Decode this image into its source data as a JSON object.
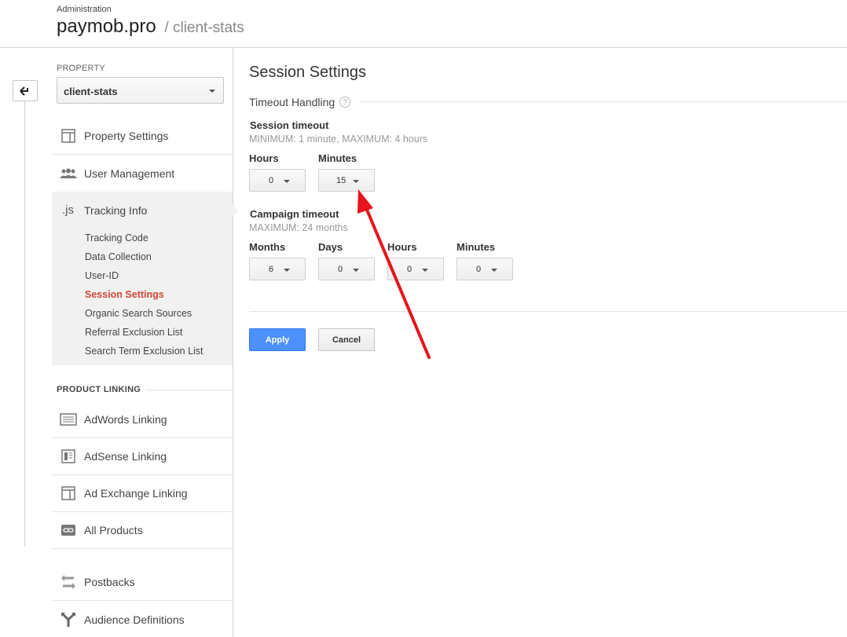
{
  "header": {
    "admin_label": "Administration",
    "account_name": "paymob.pro",
    "property_path": "/ client-stats"
  },
  "sidebar": {
    "property_label": "PROPERTY",
    "property_selected": "client-stats",
    "items": [
      {
        "label": "Property Settings",
        "icon": "property-settings-icon"
      },
      {
        "label": "User Management",
        "icon": "users-icon"
      },
      {
        "label": "Tracking Info",
        "icon": "js-icon"
      }
    ],
    "tracking_subitems": [
      {
        "label": "Tracking Code"
      },
      {
        "label": "Data Collection"
      },
      {
        "label": "User-ID"
      },
      {
        "label": "Session Settings",
        "active": true
      },
      {
        "label": "Organic Search Sources"
      },
      {
        "label": "Referral Exclusion List"
      },
      {
        "label": "Search Term Exclusion List"
      }
    ],
    "product_linking_label": "PRODUCT LINKING",
    "linking_items": [
      {
        "label": "AdWords Linking",
        "icon": "adwords-icon"
      },
      {
        "label": "AdSense Linking",
        "icon": "adsense-icon"
      },
      {
        "label": "Ad Exchange Linking",
        "icon": "ad-exchange-icon"
      },
      {
        "label": "All Products",
        "icon": "link-icon"
      }
    ],
    "other_items": [
      {
        "label": "Postbacks",
        "icon": "postbacks-icon"
      },
      {
        "label": "Audience Definitions",
        "icon": "audience-icon"
      }
    ]
  },
  "main": {
    "title": "Session Settings",
    "section": "Timeout Handling",
    "help_glyph": "?",
    "session_timeout": {
      "title": "Session timeout",
      "hint": "MINIMUM: 1 minute, MAXIMUM: 4 hours",
      "hours_label": "Hours",
      "hours_value": "0",
      "minutes_label": "Minutes",
      "minutes_value": "15"
    },
    "campaign_timeout": {
      "title": "Campaign timeout",
      "hint": "MAXIMUM: 24 months",
      "months_label": "Months",
      "months_value": "6",
      "days_label": "Days",
      "days_value": "0",
      "hours_label": "Hours",
      "hours_value": "0",
      "minutes_label": "Minutes",
      "minutes_value": "0"
    },
    "apply_label": "Apply",
    "cancel_label": "Cancel"
  },
  "colors": {
    "active_nav": "#d14836",
    "apply_button": "#4d90fe",
    "annotation_arrow": "#e8141b"
  }
}
